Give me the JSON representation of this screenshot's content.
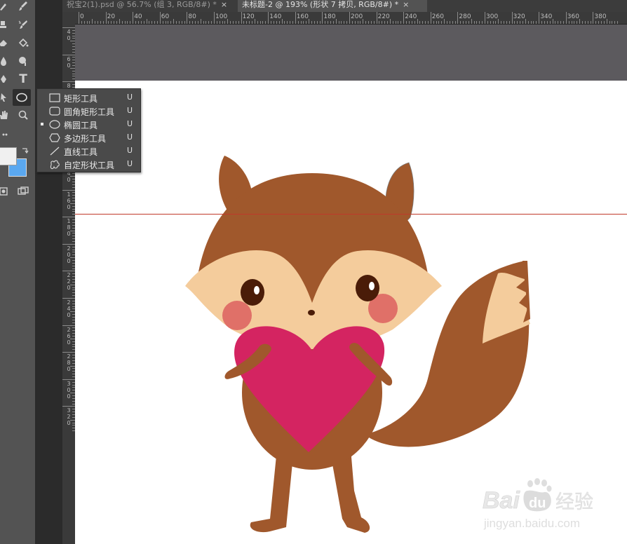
{
  "tabs": [
    {
      "label": "祝宝2(1).psd @ 56.7% (组 3, RGB/8#) *",
      "close": "×",
      "active": false
    },
    {
      "label": "未标题-2 @ 193% (形状 7 拷贝, RGB/8#) *",
      "close": "×",
      "active": true
    }
  ],
  "ruler": {
    "top_labels": [
      "0",
      "20",
      "40",
      "60",
      "80",
      "100",
      "120",
      "140",
      "160",
      "180",
      "200",
      "220",
      "240",
      "260",
      "280",
      "300",
      "320",
      "340",
      "360",
      "380"
    ],
    "left_labels": [
      "40",
      "60",
      "80",
      "100",
      "120",
      "140",
      "160",
      "180",
      "200",
      "220",
      "240",
      "260",
      "280",
      "300",
      "320"
    ]
  },
  "tools": {
    "brush": "brush-icon",
    "type_tool": "T",
    "ellipse_tool": "ellipse-icon",
    "zoom_tool": "zoom-icon",
    "hand_tool": "hand-icon",
    "colors": {
      "foreground": "#f0f0f0",
      "background": "#5aa8f0"
    }
  },
  "shape_menu": {
    "items": [
      {
        "label": "矩形工具",
        "key": "U",
        "icon": "rectangle-icon",
        "selected": false
      },
      {
        "label": "圆角矩形工具",
        "key": "U",
        "icon": "rounded-rectangle-icon",
        "selected": false
      },
      {
        "label": "椭圆工具",
        "key": "U",
        "icon": "ellipse-icon",
        "selected": true
      },
      {
        "label": "多边形工具",
        "key": "U",
        "icon": "polygon-icon",
        "selected": false
      },
      {
        "label": "直线工具",
        "key": "U",
        "icon": "line-icon",
        "selected": false
      },
      {
        "label": "自定形状工具",
        "key": "U",
        "icon": "custom-shape-icon",
        "selected": false
      }
    ]
  },
  "watermark": {
    "brand": "Bai",
    "paw": "du",
    "cn": "经验",
    "url": "jingyan.baidu.com"
  },
  "colors": {
    "fox_body": "#a0582c",
    "fox_face": "#f4cc9c",
    "heart": "#d42461",
    "cheek": "#e07068",
    "eye": "#4a1c08",
    "guide": "#c0392b"
  }
}
